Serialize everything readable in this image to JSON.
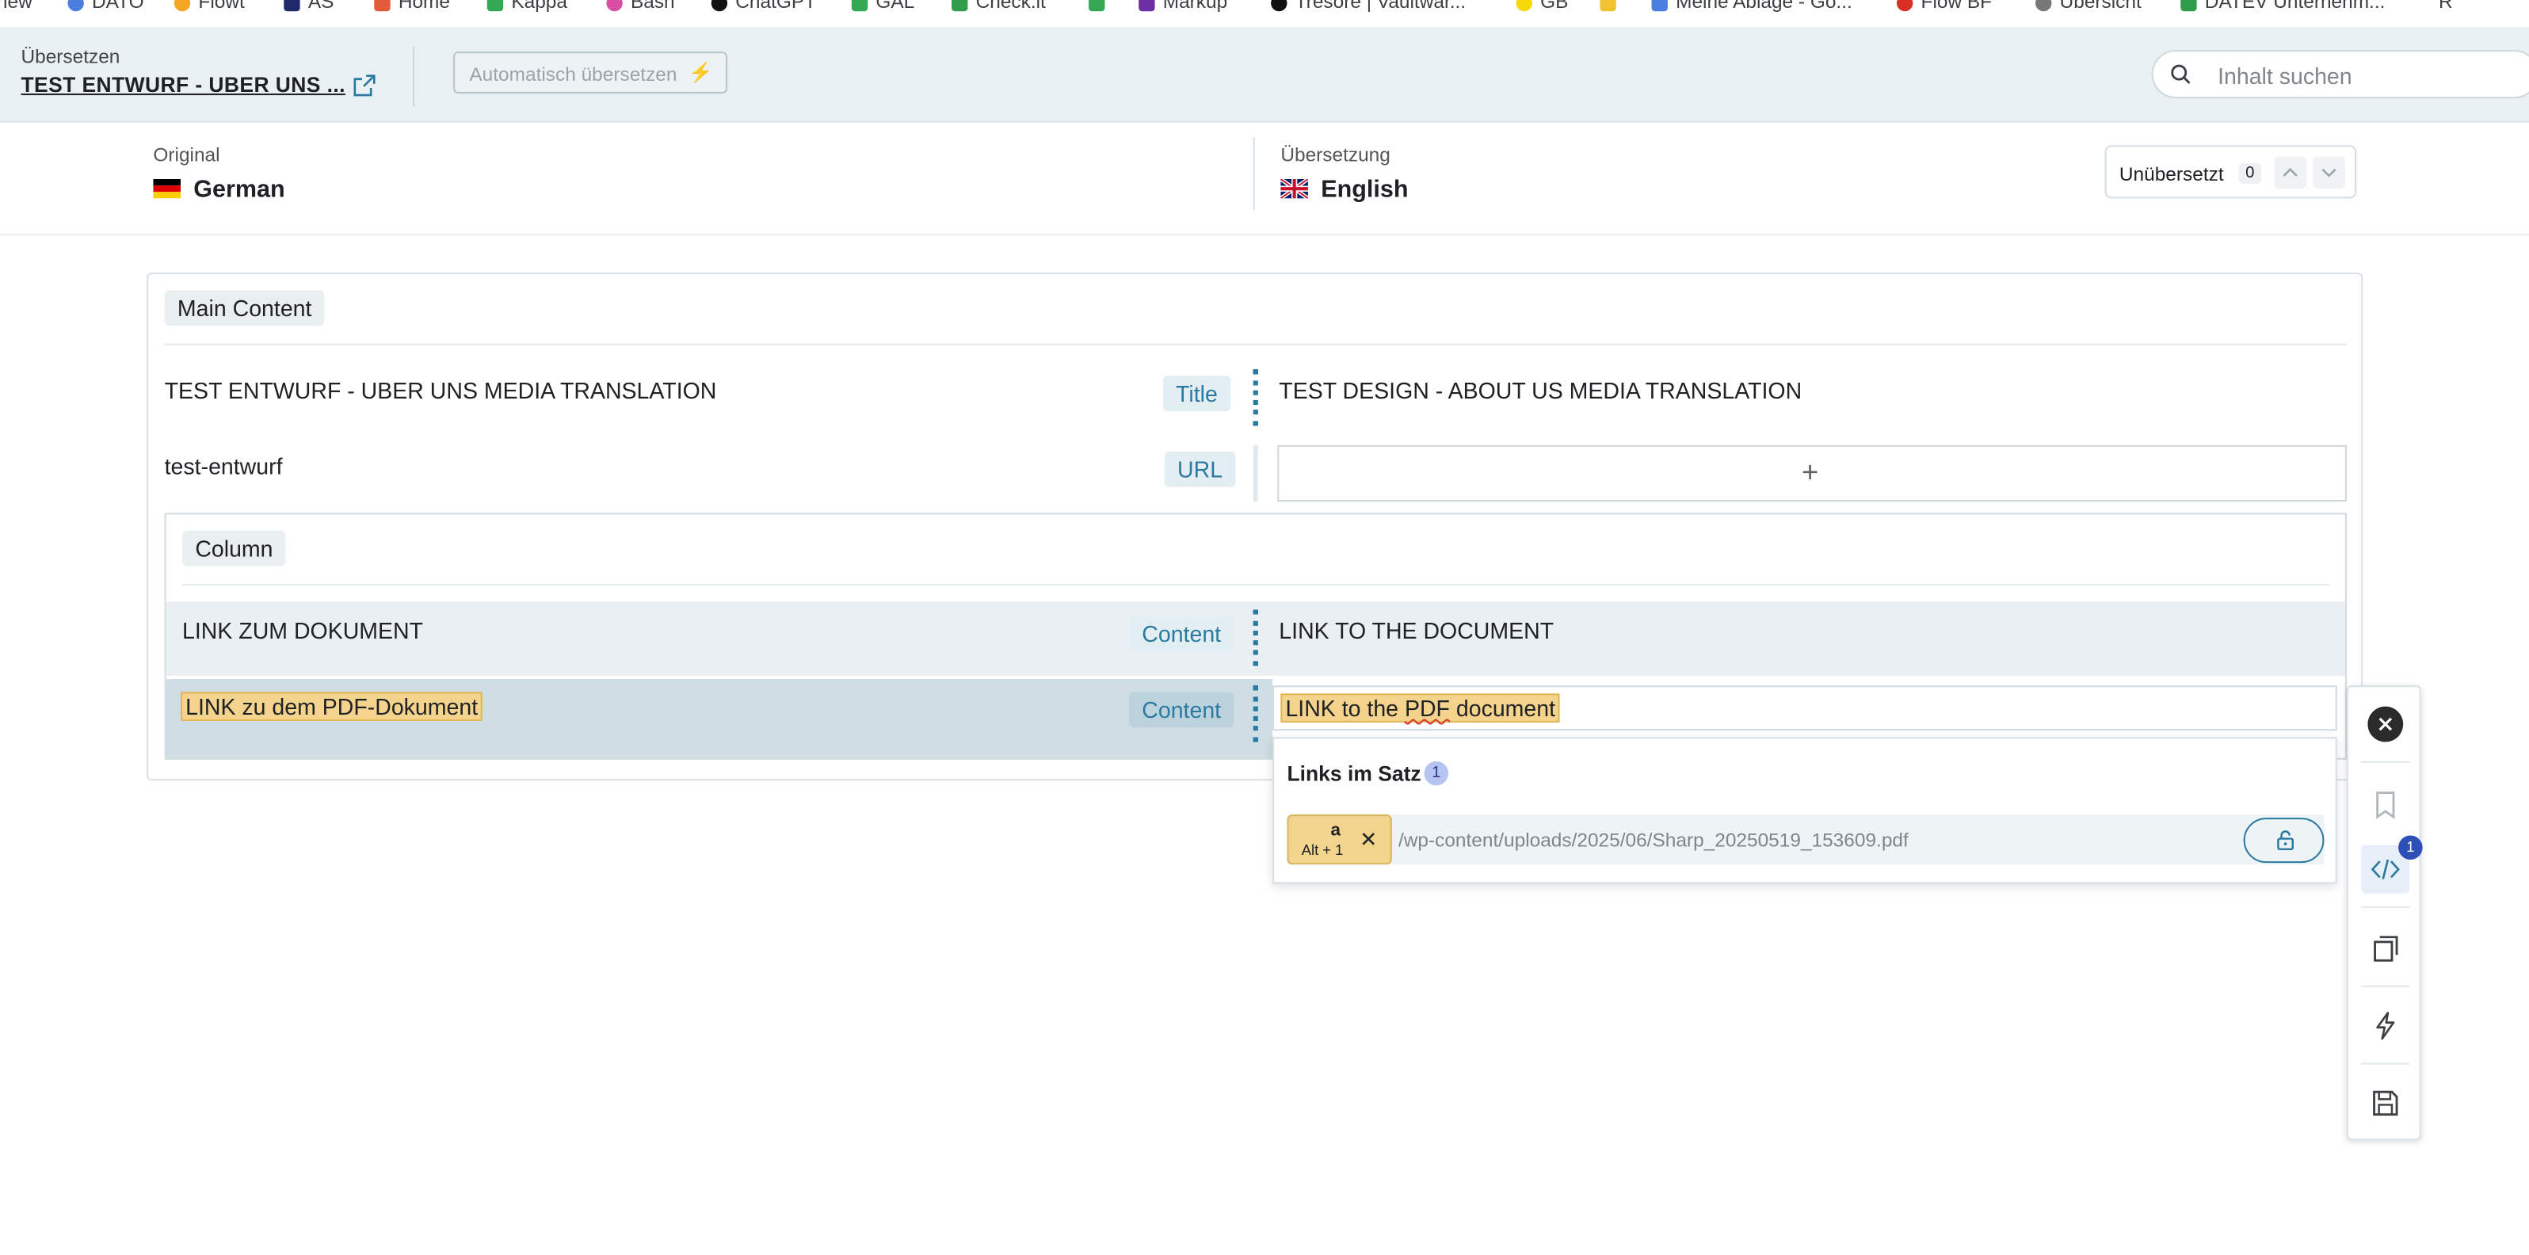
{
  "bookmarks": [
    "new",
    "DATO",
    "Flowt",
    "AS",
    "Home",
    "Kappa",
    "Bash",
    "ChatGPT",
    "GAL",
    "Check.it",
    "",
    "Markup",
    "Tresore | Vaultwar...",
    "GB",
    "",
    "Meine Ablage - Go...",
    "Flow BF",
    "Übersicht",
    "DATEV Unternehm...",
    "R"
  ],
  "header": {
    "label": "Übersetzen",
    "title": "TEST ENTWURF - UBER UNS ...",
    "auto_translate": "Automatisch übersetzen",
    "search_placeholder": "Inhalt suchen"
  },
  "languages": {
    "original_label": "Original",
    "original_name": "German",
    "translation_label": "Übersetzung",
    "translation_name": "English",
    "untranslated_label": "Unübersetzt",
    "untranslated_count": "0"
  },
  "main": {
    "section_label": "Main Content",
    "rows": [
      {
        "source": "TEST ENTWURF - UBER UNS MEDIA TRANSLATION",
        "type": "Title",
        "target": "TEST DESIGN - ABOUT US MEDIA TRANSLATION"
      },
      {
        "source": "test-entwurf",
        "type": "URL",
        "target": "+"
      }
    ],
    "column": {
      "label": "Column",
      "rows": [
        {
          "source": "LINK ZUM DOKUMENT",
          "type": "Content",
          "target": "LINK TO THE DOCUMENT"
        },
        {
          "source": "LINK zu dem PDF-Dokument",
          "type": "Content",
          "target_prefix": "LINK to the ",
          "target_misspelled": "PDF",
          "target_suffix": " document"
        }
      ]
    }
  },
  "links_panel": {
    "title": "Links im Satz",
    "count": "1",
    "tag": "a",
    "shortcut": "Alt + 1",
    "url": "/wp-content/uploads/2025/06/Sharp_20250519_153609.pdf"
  },
  "toolbar": {
    "code_badge": "1"
  },
  "colors": {
    "accent": "#2a7aa0",
    "highlight": "#f4d48c",
    "header_bg": "#e9f1f5"
  }
}
